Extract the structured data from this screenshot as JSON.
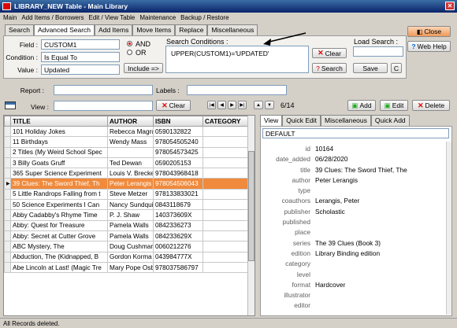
{
  "window": {
    "title": "LIBRARY_NEW Table - Main Library"
  },
  "menu": [
    "Main",
    "Add Items / Borrowers",
    "Edit / View Table",
    "Maintenance",
    "Backup / Restore"
  ],
  "tabs": [
    "Search",
    "Advanced Search",
    "Add Items",
    "Move Items",
    "Replace",
    "Miscellaneous"
  ],
  "search": {
    "field_label": "Field :",
    "field_value": "CUSTOM1",
    "condition_label": "Condition :",
    "condition_value": "Is Equal To",
    "value_label": "Value :",
    "value_value": "Updated",
    "and_label": "AND",
    "or_label": "OR",
    "include_label": "Include =>",
    "conditions_label": "Search Conditions :",
    "conditions_text": "UPPER(CUSTOM1)='UPDATED'",
    "clear_label": "Clear",
    "search_label": "Search",
    "load_label": "Load Search :",
    "save_label": "Save",
    "c_label": "C",
    "close_label": "Close",
    "webhelp_label": "Web Help"
  },
  "filters": {
    "report_label": "Report :",
    "labels_label": "Labels :",
    "view_label": "View :",
    "clear_label": "Clear",
    "record_count": "6/14",
    "add_label": "Add",
    "edit_label": "Edit",
    "delete_label": "Delete"
  },
  "table": {
    "headers": [
      "TITLE",
      "AUTHOR",
      "ISBN",
      "CATEGORY"
    ],
    "rows": [
      [
        "101 Holiday Jokes",
        "Rebecca Magru",
        "0590132822",
        ""
      ],
      [
        "11 Birthdays",
        "Wendy Mass",
        "978054505240",
        ""
      ],
      [
        "2 Titles (My Weird School Spec",
        "",
        "978054573425",
        ""
      ],
      [
        "3 Billy Goats Gruff",
        "Ted Dewan",
        "0590205153",
        ""
      ],
      [
        "365 Super Science Experiment",
        "Louis V. Brecke",
        "978043968418",
        ""
      ],
      [
        "39 Clues: The Sword Thief, Th",
        "Peter Lerangis",
        "978054506043",
        ""
      ],
      [
        "5 Little Randrops Falling from t",
        "Steve Metzer",
        "978133833021",
        ""
      ],
      [
        "50 Science Experiments I Can",
        "Nancy Sundqui",
        "0843118679",
        ""
      ],
      [
        "Abby Cadabby's Rhyme Time",
        "P. J. Shaw",
        "140373609X",
        ""
      ],
      [
        "Abby: Quest for Treasure",
        "Pamela Walls",
        "0842336273",
        ""
      ],
      [
        "Abby: Secret at Cutter Grove",
        "Pamela Walls",
        "084233629X",
        ""
      ],
      [
        "ABC Mystery, The",
        "Doug Cushman",
        "0060212276",
        ""
      ],
      [
        "Abduction, The (Kidnapped, B",
        "Gordon Korma",
        "043984777X",
        ""
      ],
      [
        "Abe Lincoln at Last! (Magic Tre",
        "Mary Pope Osb",
        "978037586797",
        ""
      ]
    ],
    "selected_index": 5
  },
  "detail": {
    "tabs": [
      "View",
      "Quick Edit",
      "Miscellaneous",
      "Quick Add"
    ],
    "view_select": "DEFAULT",
    "fields": [
      {
        "k": "id",
        "v": "10164"
      },
      {
        "k": "date_added",
        "v": "06/28/2020"
      },
      {
        "k": "title",
        "v": "39 Clues: The Sword Thief, The"
      },
      {
        "k": "author",
        "v": "Peter Lerangis"
      },
      {
        "k": "type",
        "v": ""
      },
      {
        "k": "coauthors",
        "v": "Lerangis, Peter"
      },
      {
        "k": "publisher",
        "v": "Scholastic"
      },
      {
        "k": "published",
        "v": ""
      },
      {
        "k": "place",
        "v": ""
      },
      {
        "k": "series",
        "v": "The 39 Clues (Book 3)"
      },
      {
        "k": "edition",
        "v": "Library Binding edition"
      },
      {
        "k": "category",
        "v": ""
      },
      {
        "k": "level",
        "v": ""
      },
      {
        "k": "format",
        "v": "Hardcover"
      },
      {
        "k": "illustrator",
        "v": ""
      },
      {
        "k": "editor",
        "v": ""
      }
    ]
  },
  "status": "All Records deleted."
}
